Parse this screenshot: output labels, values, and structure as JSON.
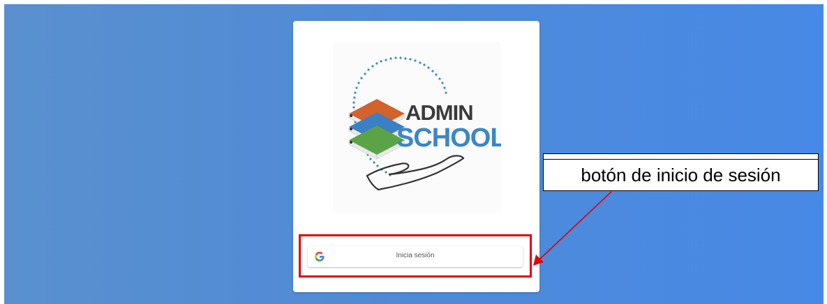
{
  "logo": {
    "line1": "ADMIN",
    "line2": "SCHOOL",
    "colors": {
      "orange": "#d4622c",
      "blue": "#3b7fc4",
      "green": "#5aa447",
      "dots": "#3a8bc6",
      "text_dark": "#3a3a3a",
      "text_blue": "#3b86c6"
    }
  },
  "login_button": {
    "label": "Inicia sesión",
    "icon": "google-g-icon"
  },
  "annotation": {
    "text": "botón de inicio de sesión",
    "highlight_color": "#e60000",
    "arrow_color": "#e60000"
  }
}
